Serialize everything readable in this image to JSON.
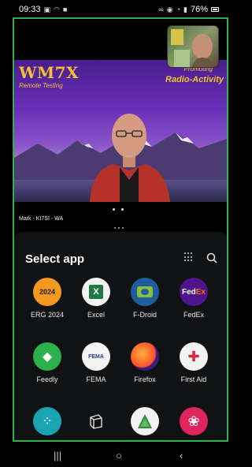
{
  "status": {
    "time": "09:33",
    "battery": "76%"
  },
  "video": {
    "brand_title": "WM7X",
    "brand_subtitle": "Remote Testing",
    "promo_line1": "Promoting",
    "promo_line2": "Radio-Activity",
    "caller": "Mark - KI7SI - WA"
  },
  "app_panel": {
    "title": "Select app",
    "apps": [
      {
        "label": "ERG 2024",
        "icon": "erg-2024-icon",
        "color": "#f39a1e"
      },
      {
        "label": "Excel",
        "icon": "excel-icon",
        "color": "#f2f2f2"
      },
      {
        "label": "F-Droid",
        "icon": "fdroid-icon",
        "color": "#1f5d9e"
      },
      {
        "label": "FedEx",
        "icon": "fedex-icon",
        "color": "#4d148c"
      },
      {
        "label": "Feedly",
        "icon": "feedly-icon",
        "color": "#2bb24c"
      },
      {
        "label": "FEMA",
        "icon": "fema-icon",
        "color": "#f4f4f4"
      },
      {
        "label": "Firefox",
        "icon": "firefox-icon",
        "color": "#3d1a78"
      },
      {
        "label": "First Aid",
        "icon": "first-aid-icon",
        "color": "#f2f2f2"
      },
      {
        "label": "",
        "icon": "fitbit-icon",
        "color": "#1aa3b0"
      },
      {
        "label": "",
        "icon": "cube-app-icon",
        "color": "#111214"
      },
      {
        "label": "",
        "icon": "trees-app-icon",
        "color": "#f2f2f2"
      },
      {
        "label": "",
        "icon": "flower-app-icon",
        "color": "#e0245e"
      }
    ]
  },
  "colors": {
    "frame": "#2fb14a",
    "brand_text": "#f2c230"
  }
}
